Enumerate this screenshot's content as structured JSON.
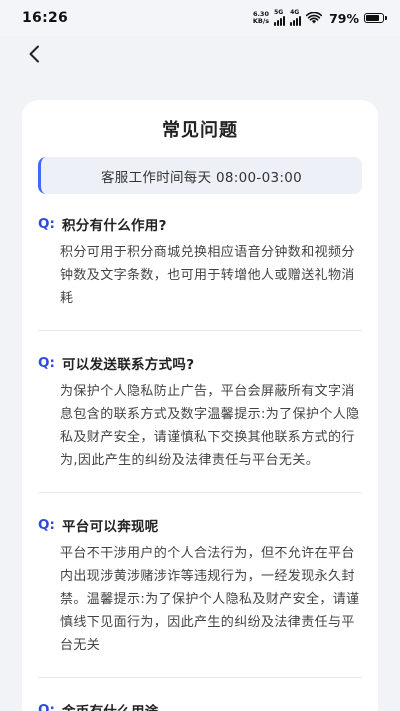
{
  "status_bar": {
    "time": "16:26",
    "net_speed_value": "6.30",
    "net_speed_unit": "KB/s",
    "signal_1_label": "5G",
    "signal_2_label": "4G",
    "battery_percent": "79%"
  },
  "nav": {
    "back_icon": "chevron-left-icon"
  },
  "card": {
    "title": "常见问题",
    "service_hours": "客服工作时间每天 08:00-03:00"
  },
  "faq": [
    {
      "q_mark": "Q:",
      "question": "积分有什么作用?",
      "answer": "积分可用于积分商城兑换相应语音分钟数和视频分钟数及文字条数，也可用于转增他人或赠送礼物消耗"
    },
    {
      "q_mark": "Q:",
      "question": "可以发送联系方式吗?",
      "answer": "为保护个人隐私防止广告，平台会屏蔽所有文字消息包含的联系方式及数字温馨提示:为了保护个人隐私及财产安全，请谨慎私下交换其他联系方式的行为,因此产生的纠纷及法律责任与平台无关。"
    },
    {
      "q_mark": "Q:",
      "question": "平台可以奔现呢",
      "answer": "平台不干涉用户的个人合法行为，但不允许在平台内出现涉黄涉赌涉诈等违规行为，一经发现永久封禁。温馨提示:为了保护个人隐私及财产安全，请谨慎线下见面行为，因此产生的纠纷及法律责任与平台无关"
    },
    {
      "q_mark": "Q:",
      "question": "金币有什么用途",
      "answer": ""
    }
  ]
}
